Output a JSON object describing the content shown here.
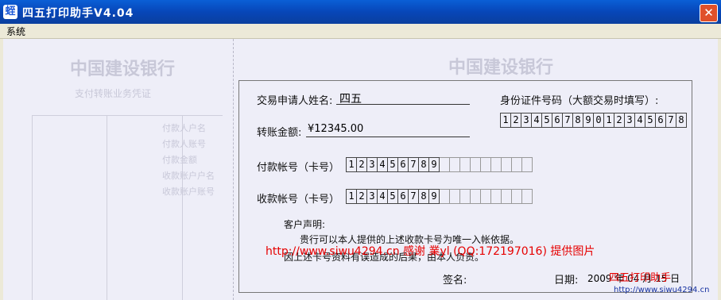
{
  "window": {
    "title": "四五打印助手V4.04",
    "app_icon_glyph": "蛭",
    "close_glyph": "✕"
  },
  "menu": {
    "items": [
      "系统"
    ]
  },
  "slip": {
    "left_faint": {
      "bank_name": "中国建设银行",
      "doc_title": "支付转账业务凭证",
      "rows": [
        "付款人户名",
        "付款人账号",
        "付款金额",
        "收款账户户名",
        "收款账户账号"
      ]
    },
    "form": {
      "applicant_label": "交易申请人姓名:",
      "applicant_value": "四五",
      "id_label": "身份证件号码（大额交易时填写）:",
      "id_digits": [
        "1",
        "2",
        "3",
        "4",
        "5",
        "6",
        "7",
        "8",
        "9",
        "0",
        "1",
        "2",
        "3",
        "4",
        "5",
        "6",
        "7",
        "8"
      ],
      "amount_label": "转账金额:",
      "amount_value": "¥12345.00",
      "payer_label": "付款帐号（卡号）",
      "payer_digits": [
        "1",
        "2",
        "3",
        "4",
        "5",
        "6",
        "7",
        "8",
        "9",
        "",
        "",
        "",
        "",
        "",
        "",
        "",
        "",
        ""
      ],
      "payee_label": "收款帐号（卡号）",
      "payee_digits": [
        "1",
        "2",
        "3",
        "4",
        "5",
        "6",
        "7",
        "8",
        "9",
        "",
        "",
        "",
        "",
        "",
        "",
        "",
        "",
        ""
      ],
      "statement_title": "客户声明:",
      "statement_line1": "贵行可以本人提供的上述收款卡号为唯一入帐依据。",
      "statement_line2": "因上述卡号资料有误造成的后果，由本人负责。",
      "sign_label": "签名:",
      "date_label": "日期:",
      "date_value": "2009 年 04 月 15 日"
    }
  },
  "watermark": {
    "credit": "http://www.siwu4294.cn 感谢 業yl (QQ:172197016)  提供图片",
    "brand": "四五打印助手",
    "url": "http://www.siwu4294.cn"
  },
  "colors": {
    "title_bar": "#0746b8",
    "watermark_red": "#e60000",
    "paper": "#eeeef8"
  }
}
